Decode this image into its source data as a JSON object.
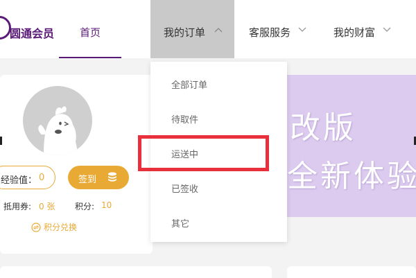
{
  "brand": {
    "name": "圆通会员",
    "color": "#5a1b78"
  },
  "nav": {
    "home": "首页",
    "orders": "我的订单",
    "service": "客服服务",
    "wealth": "我的财富"
  },
  "orders_menu": {
    "items": [
      {
        "label": "全部订单",
        "highlighted": false
      },
      {
        "label": "待取件",
        "highlighted": false
      },
      {
        "label": "运送中",
        "highlighted": true
      },
      {
        "label": "已签收",
        "highlighted": false
      },
      {
        "label": "其它",
        "highlighted": false
      }
    ]
  },
  "profile": {
    "exp_label": "经验值：",
    "exp_value": "0",
    "checkin_label": "签到",
    "coupon_label": "抵用券:",
    "coupon_value": "0 张",
    "points_label": "积分:",
    "points_value": "10",
    "exchange_label": "积分兑换"
  },
  "banner": {
    "line1": "改版",
    "line2": "全新体验"
  },
  "colors": {
    "accent": "#e9a935",
    "highlight": "#e8303d",
    "banner_bg": "#dccbef",
    "active_menu_bg": "#c9c9c9"
  }
}
